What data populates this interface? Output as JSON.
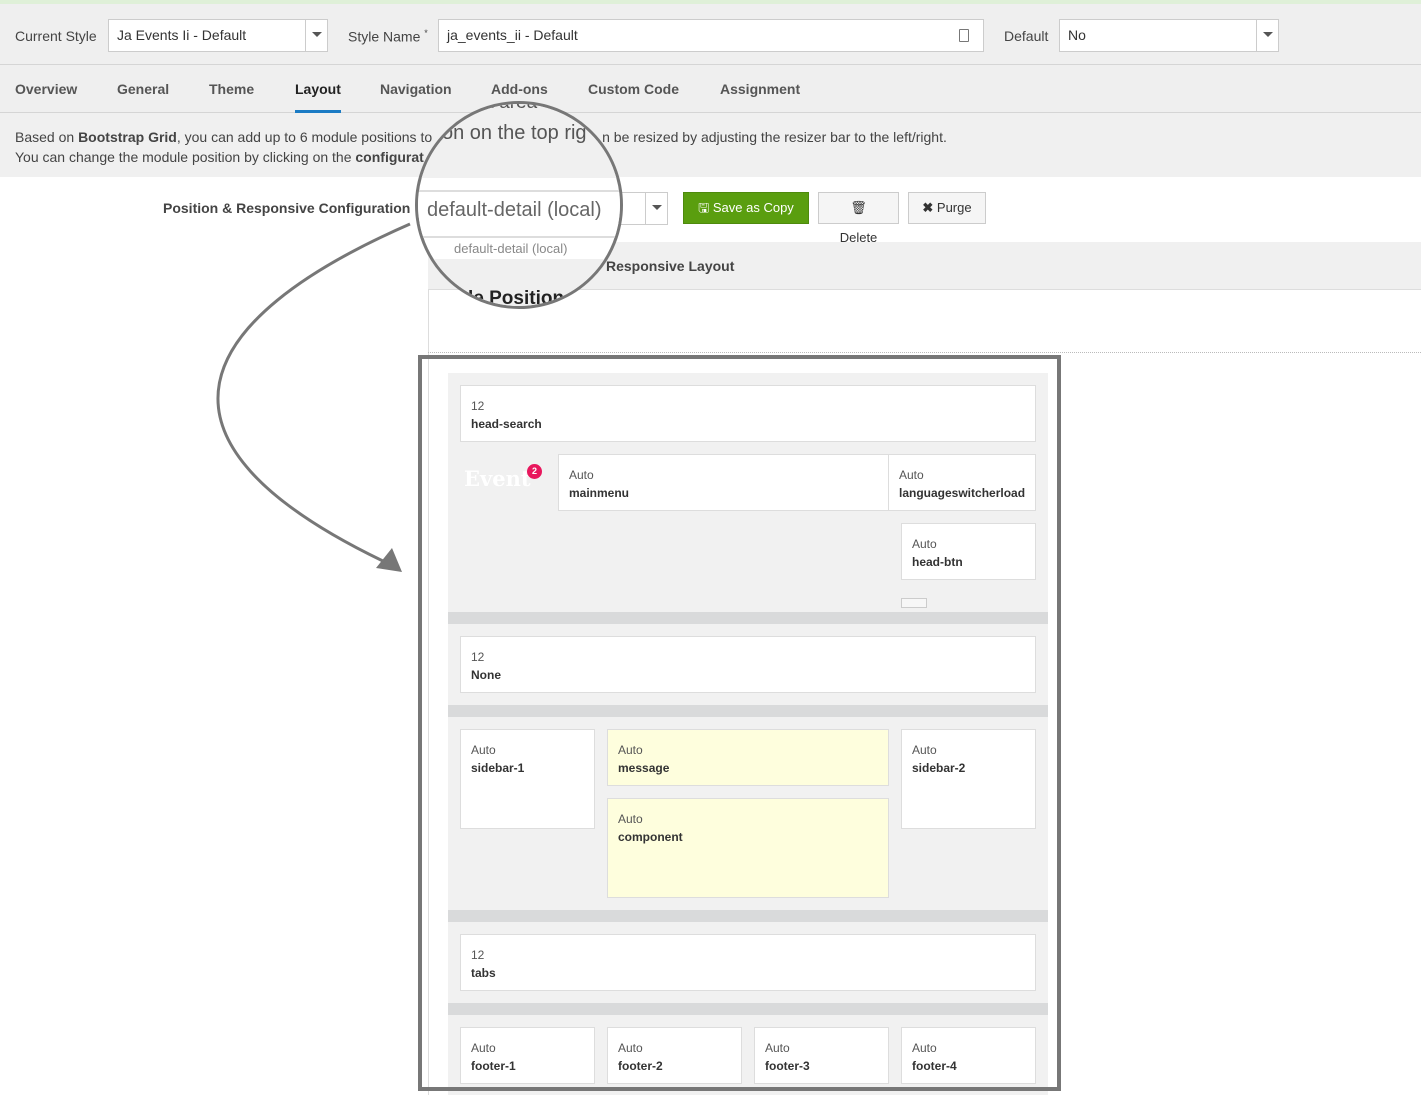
{
  "header": {
    "current_style_label": "Current Style",
    "current_style_value": "Ja Events Ii - Default",
    "style_name_label": "Style Name",
    "required_mark": "*",
    "style_name_value": "ja_events_ii - Default",
    "default_label": "Default",
    "default_value": "No"
  },
  "tabs": [
    "Overview",
    "General",
    "Theme",
    "Layout",
    "Navigation",
    "Add-ons",
    "Custom Code",
    "Assignment"
  ],
  "info": {
    "l1a": "Based on ",
    "l1b": "Bootstrap Grid",
    "l1c": ", you can add up to 6 module positions to",
    "l1d": "n be resized by adjusting the resizer bar to the left/right.",
    "l2a": "You can change the module position by clicking on the ",
    "l2b": "configurat"
  },
  "position": {
    "label": "Position & Responsive Configuration",
    "select_value": "default-detail (local)",
    "save_copy": "Save as Copy",
    "delete": "Delete",
    "purge": "Purge"
  },
  "responsive_layout": "Responsive Layout",
  "magnifier": {
    "t1": "ht area",
    "t2": "on on the top rig",
    "t3": "default-detail (local)",
    "t4": "le Position"
  },
  "logo": {
    "text": "Event",
    "badge": "2"
  },
  "modules": [
    {
      "w": "12",
      "n": "head-search"
    },
    {
      "w": "Auto",
      "n": "mainmenu"
    },
    {
      "w": "Auto",
      "n": "languageswitcherload"
    },
    {
      "w": "Auto",
      "n": "head-btn"
    },
    {
      "w": "12",
      "n": "None"
    },
    {
      "w": "Auto",
      "n": "sidebar-1"
    },
    {
      "w": "Auto",
      "n": "message"
    },
    {
      "w": "Auto",
      "n": "component"
    },
    {
      "w": "Auto",
      "n": "sidebar-2"
    },
    {
      "w": "12",
      "n": "tabs"
    },
    {
      "w": "Auto",
      "n": "footer-1"
    },
    {
      "w": "Auto",
      "n": "footer-2"
    },
    {
      "w": "Auto",
      "n": "footer-3"
    },
    {
      "w": "Auto",
      "n": "footer-4"
    }
  ],
  "colors": {
    "accent": "#1b7bc4",
    "green": "#5a9e0f",
    "highlight": "#fefedd",
    "badge": "#e8175d"
  }
}
